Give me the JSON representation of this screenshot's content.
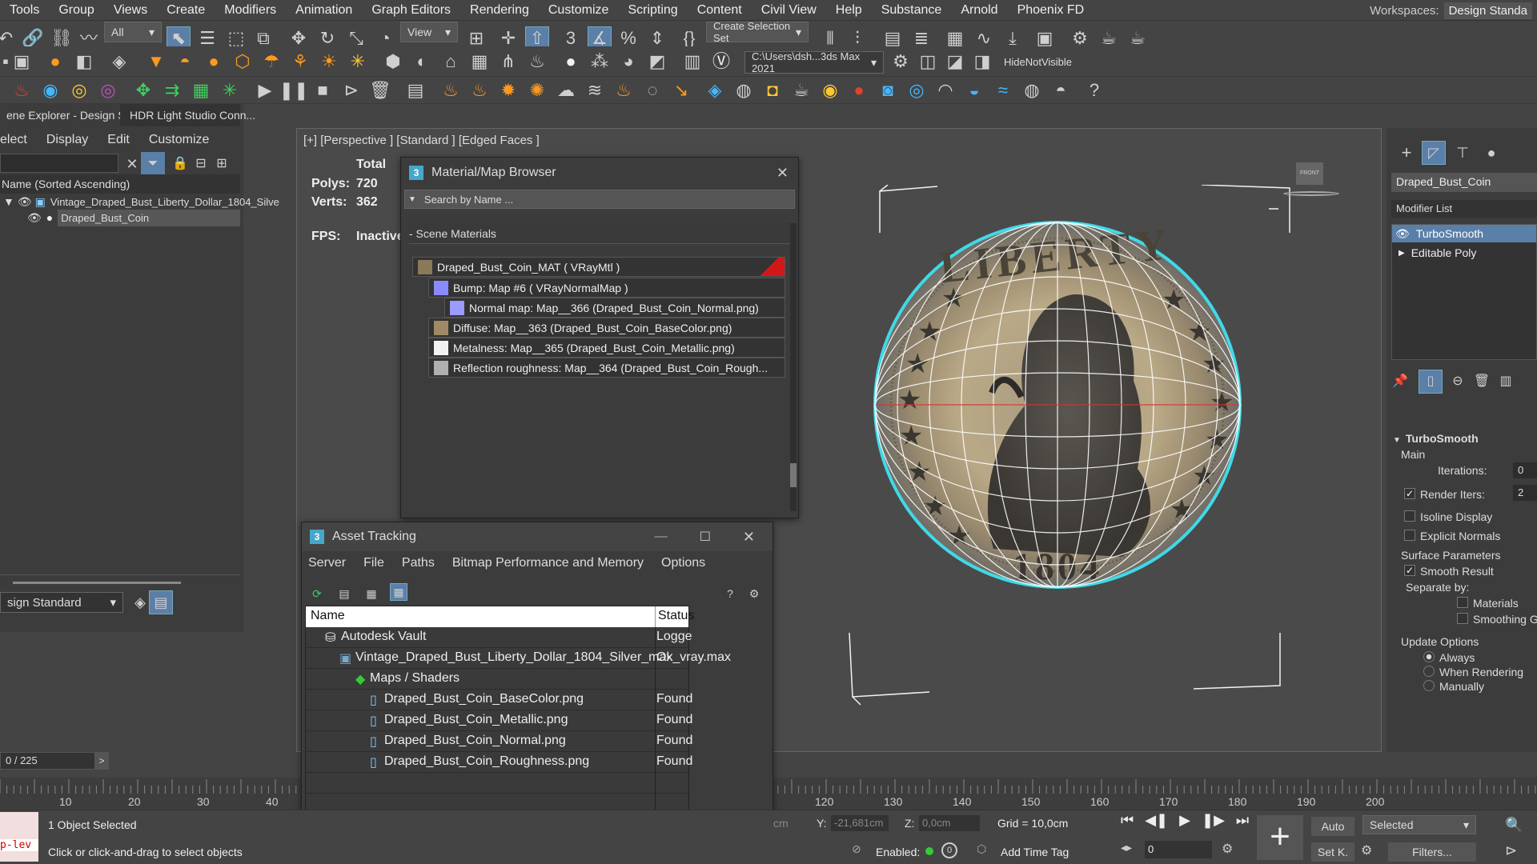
{
  "menu": [
    "Tools",
    "Group",
    "Views",
    "Create",
    "Modifiers",
    "Animation",
    "Graph Editors",
    "Rendering",
    "Customize",
    "Scripting",
    "Content",
    "Civil View",
    "Help",
    "Substance",
    "Arnold",
    "Phoenix FD"
  ],
  "workspaces": {
    "label": "Workspaces:",
    "value": "Design Standa"
  },
  "toolbar": {
    "filter_all": "All",
    "view_dd": "View",
    "create_selection_set": "Create Selection Set",
    "path": "C:\\Users\\dsh...3ds Max 2021",
    "hide_not_visible": "HideNotVisible"
  },
  "scene_explorer": {
    "tab1": "ene Explorer - Design Sta...",
    "tab2": "HDR Light Studio Conn...",
    "menu": [
      "elect",
      "Display",
      "Edit",
      "Customize"
    ],
    "column": "Name (Sorted Ascending)",
    "root": "Vintage_Draped_Bust_Liberty_Dollar_1804_Silve",
    "child": "Draped_Bust_Coin",
    "layer": "sign Standard",
    "frame": "0 / 225"
  },
  "viewport": {
    "label": "[+] [Perspective ] [Standard ] [Edged Faces ]",
    "stats_total": "Total",
    "polys_label": "Polys:",
    "polys": "720",
    "verts_label": "Verts:",
    "verts": "362",
    "fps_label": "FPS:",
    "fps": "Inactive",
    "coin_top": "LIBERTY",
    "coin_year": "1804",
    "viewcube": "FRONT"
  },
  "material_browser": {
    "title": "Material/Map Browser",
    "search_placeholder": "Search by Name ...",
    "section": "- Scene Materials",
    "items": [
      "Draped_Bust_Coin_MAT  ( VRayMtl )",
      "Bump: Map #6  ( VRayNormalMap )",
      "Normal map: Map__366 (Draped_Bust_Coin_Normal.png)",
      "Diffuse: Map__363 (Draped_Bust_Coin_BaseColor.png)",
      "Metalness: Map__365 (Draped_Bust_Coin_Metallic.png)",
      "Reflection  roughness:  Map__364  (Draped_Bust_Coin_Rough..."
    ]
  },
  "asset_tracking": {
    "title": "Asset Tracking",
    "menu": [
      "Server",
      "File",
      "Paths",
      "Bitmap Performance and Memory",
      "Options"
    ],
    "col_name": "Name",
    "col_status": "Status",
    "rows": [
      {
        "name": "Autodesk Vault",
        "status": "Logge"
      },
      {
        "name": "Vintage_Draped_Bust_Liberty_Dollar_1804_Silver_max_vray.max",
        "status": "Ok"
      },
      {
        "name": "Maps / Shaders",
        "status": ""
      },
      {
        "name": "Draped_Bust_Coin_BaseColor.png",
        "status": "Found"
      },
      {
        "name": "Draped_Bust_Coin_Metallic.png",
        "status": "Found"
      },
      {
        "name": "Draped_Bust_Coin_Normal.png",
        "status": "Found"
      },
      {
        "name": "Draped_Bust_Coin_Roughness.png",
        "status": "Found"
      }
    ]
  },
  "command_panel": {
    "object_name": "Draped_Bust_Coin",
    "modifier_list": "Modifier List",
    "stack": [
      "TurboSmooth",
      "Editable Poly"
    ],
    "rollout": "TurboSmooth",
    "main": "Main",
    "iterations_label": "Iterations:",
    "iterations": "0",
    "render_iters_label": "Render Iters:",
    "render_iters": "2",
    "isoline": "Isoline Display",
    "explicit": "Explicit Normals",
    "surface": "Surface Parameters",
    "smooth_result": "Smooth Result",
    "separate_by": "Separate by:",
    "materials": "Materials",
    "smoothing": "Smoothing Gr",
    "update_options": "Update Options",
    "always": "Always",
    "when_rendering": "When Rendering",
    "manually": "Manually"
  },
  "timeline": {
    "ticks_left": [
      "10",
      "20",
      "30",
      "40"
    ],
    "ticks_right": [
      "120",
      "130",
      "140",
      "150",
      "160",
      "170",
      "180",
      "190",
      "200"
    ]
  },
  "status": {
    "script": "p-lev",
    "selected": "1 Object Selected",
    "prompt": "Click or click-and-drag to select objects",
    "cm": "cm",
    "y_label": "Y:",
    "y": "-21,681cm",
    "z_label": "Z:",
    "z": "0,0cm",
    "grid": "Grid = 10,0cm",
    "enabled": "Enabled:",
    "add_time_tag": "Add Time Tag",
    "auto": "Auto",
    "selected_dd": "Selected",
    "setk": "Set K.",
    "filters": "Filters...",
    "frame": "0"
  },
  "colors": {
    "accent": "#4a8fd0",
    "selection": "#5a7fa8",
    "cyan_outline": "#3fd9e8",
    "material_red": "#d01818"
  }
}
